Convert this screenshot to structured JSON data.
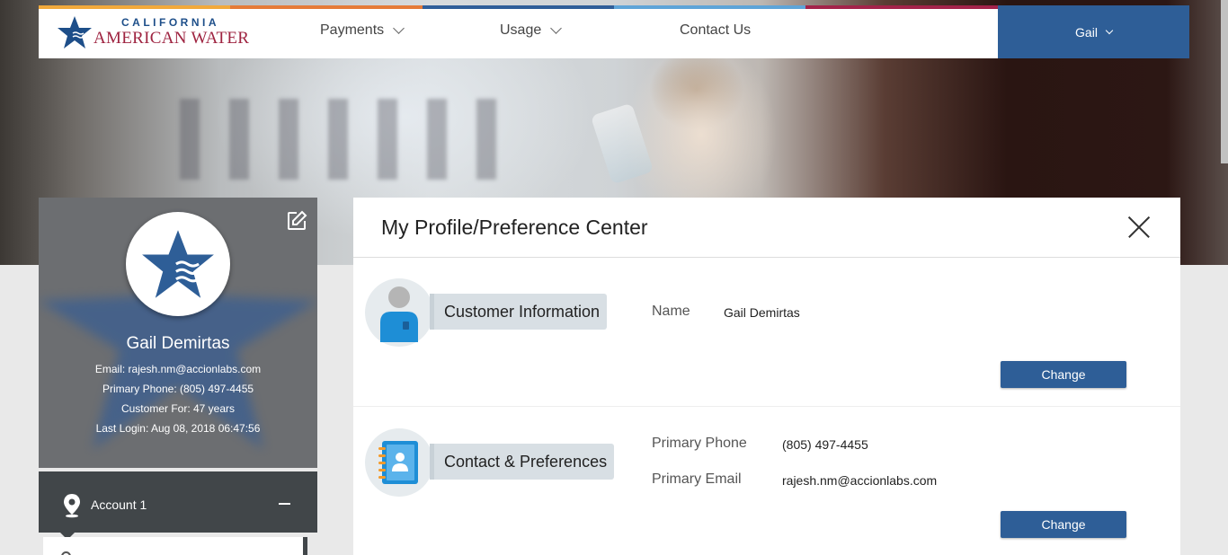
{
  "brand": {
    "line1": "CALIFORNIA",
    "line2": "AMERICAN WATER",
    "stripe_colors": [
      "#f2a93b",
      "#e57b38",
      "#2f5e99",
      "#5ea4d8",
      "#a3234a",
      "#c5233f"
    ]
  },
  "nav": {
    "items": [
      {
        "label": "Payments",
        "has_dropdown": true
      },
      {
        "label": "Usage",
        "has_dropdown": true
      },
      {
        "label": "Contact Us",
        "has_dropdown": false
      }
    ],
    "user": {
      "label": "Gail",
      "icon": "chevron-down-icon"
    }
  },
  "profile": {
    "name": "Gail Demirtas",
    "email": "Email: rajesh.nm@accionlabs.com",
    "phone": "Primary Phone: (805) 497-4455",
    "customer_for": "Customer For: 47 years",
    "last_login": "Last Login: Aug 08, 2018 06:47:56",
    "edit_icon": "edit-icon"
  },
  "account": {
    "label": "Account 1",
    "pin_icon": "location-pin-icon",
    "collapse_icon": "minus-icon"
  },
  "panel": {
    "title": "My Profile/Preference Center",
    "sections": [
      {
        "title": "Customer Information",
        "icon": "user-icon",
        "fields": [
          {
            "label": "Name",
            "value": "Gail Demirtas"
          }
        ],
        "button": "Change"
      },
      {
        "title": "Contact & Preferences",
        "icon": "address-book-icon",
        "fields": [
          {
            "label": "Primary Phone",
            "value": "(805) 497-4455"
          },
          {
            "label": "Primary Email",
            "value": "rajesh.nm@accionlabs.com"
          }
        ],
        "button": "Change"
      }
    ]
  },
  "colors": {
    "accent": "#2e5e97",
    "brand_blue": "#1d4e89",
    "brand_red": "#9e2340",
    "account_bar": "#414649"
  }
}
